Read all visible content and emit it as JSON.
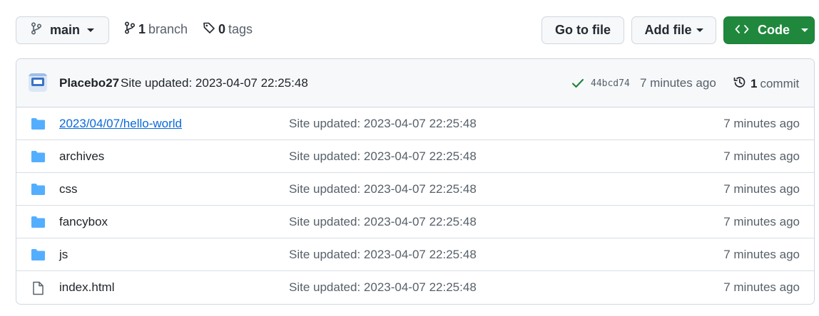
{
  "toolbar": {
    "branch_name": "main",
    "branch_count": "1",
    "branch_label": "branch",
    "tag_count": "0",
    "tag_label": "tags",
    "goto_file": "Go to file",
    "add_file": "Add file",
    "code": "Code"
  },
  "latest_commit": {
    "author": "Placebo27",
    "message": "Site updated: 2023-04-07 22:25:48",
    "sha": "44bcd74",
    "time": "7 minutes ago",
    "commit_count": "1",
    "commit_label": "commit"
  },
  "files": [
    {
      "name": "2023/04/07/hello-world",
      "type": "folder",
      "message": "Site updated: 2023-04-07 22:25:48",
      "time": "7 minutes ago"
    },
    {
      "name": "archives",
      "type": "folder",
      "message": "Site updated: 2023-04-07 22:25:48",
      "time": "7 minutes ago"
    },
    {
      "name": "css",
      "type": "folder",
      "message": "Site updated: 2023-04-07 22:25:48",
      "time": "7 minutes ago"
    },
    {
      "name": "fancybox",
      "type": "folder",
      "message": "Site updated: 2023-04-07 22:25:48",
      "time": "7 minutes ago"
    },
    {
      "name": "js",
      "type": "folder",
      "message": "Site updated: 2023-04-07 22:25:48",
      "time": "7 minutes ago"
    },
    {
      "name": "index.html",
      "type": "file",
      "message": "Site updated: 2023-04-07 22:25:48",
      "time": "7 minutes ago"
    }
  ],
  "colors": {
    "primary_button": "#1f883d",
    "folder_icon": "#54aeff",
    "link": "#0969da",
    "success_check": "#1a7f37"
  }
}
